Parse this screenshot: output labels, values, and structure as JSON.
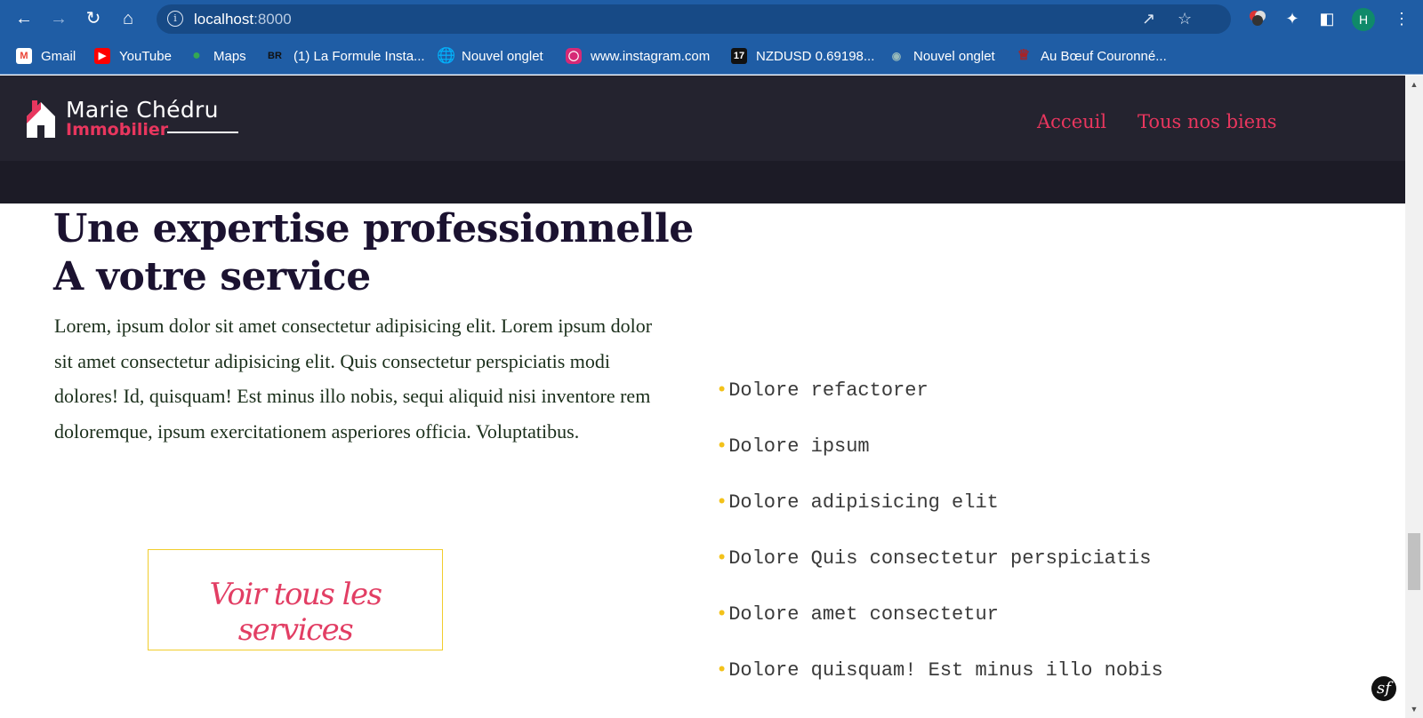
{
  "browser": {
    "url_host": "localhost",
    "url_port": ":8000",
    "profile_initial": "H",
    "bookmarks": [
      {
        "label": "Gmail",
        "icon": "gmail-icon"
      },
      {
        "label": "YouTube",
        "icon": "youtube-icon"
      },
      {
        "label": "Maps",
        "icon": "maps-icon"
      },
      {
        "label": "(1) La Formule Insta...",
        "icon": "br-icon",
        "icon_text": "BR"
      },
      {
        "label": "Nouvel onglet",
        "icon": "globe-icon"
      },
      {
        "label": "www.instagram.com",
        "icon": "instagram-icon"
      },
      {
        "label": "NZDUSD 0.69198...",
        "icon": "tradingview-icon"
      },
      {
        "label": "Nouvel onglet",
        "icon": "globe-icon"
      },
      {
        "label": "Au Bœuf Couronné...",
        "icon": "restaurant-icon"
      }
    ]
  },
  "site": {
    "logo_name": "Marie Chédru",
    "logo_sub": "Immobilier",
    "menu": [
      "Acceuil",
      "Tous nos biens"
    ]
  },
  "hero": {
    "title_line1": "Une expertise professionnelle",
    "title_line2": "A votre service",
    "text": "Lorem, ipsum dolor sit amet consectetur adipisicing elit. Lorem ipsum dolor sit amet consectetur adipisicing elit. Quis consectetur perspiciatis modi dolores! Id, quisquam! Est minus illo nobis, sequi aliquid nisi inventore rem doloremque, ipsum exercitationem asperiores officia. Voluptatibus.",
    "cta_label": "Voir tous les services"
  },
  "features": [
    "Dolore refactorer",
    "Dolore ipsum",
    "Dolore adipisicing elit",
    "Dolore Quis consectetur perspiciatis",
    "Dolore amet consectetur",
    "Dolore quisquam! Est minus illo nobis"
  ],
  "colors": {
    "chrome": "#1f5da5",
    "header": "#24232f",
    "accent": "#e8365e",
    "bullet": "#f3c21a",
    "title": "#1b1230"
  }
}
